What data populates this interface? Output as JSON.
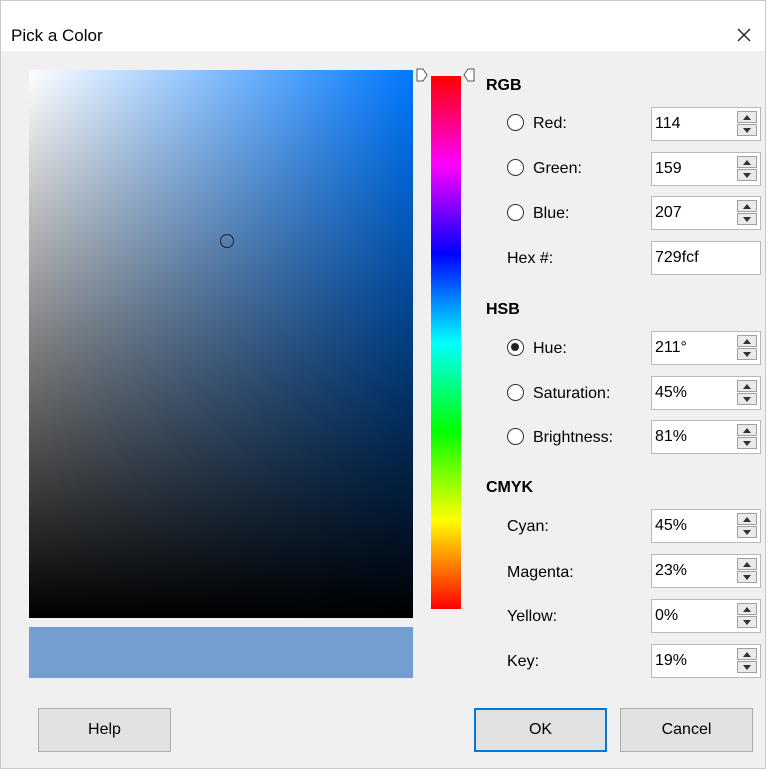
{
  "window": {
    "title": "Pick a Color",
    "close_label": "✕"
  },
  "colors": {
    "field_hue": "#0078ff",
    "preview": "#729fcf"
  },
  "rgb": {
    "heading": "RGB",
    "red": {
      "label": "Red:",
      "value": "114"
    },
    "green": {
      "label": "Green:",
      "value": "159"
    },
    "blue": {
      "label": "Blue:",
      "value": "207"
    },
    "hex": {
      "label": "Hex #:",
      "value": "729fcf"
    }
  },
  "hsb": {
    "heading": "HSB",
    "hue": {
      "label": "Hue:",
      "value": "211°",
      "selected": true
    },
    "saturation": {
      "label": "Saturation:",
      "value": "45%"
    },
    "brightness": {
      "label": "Brightness:",
      "value": "81%"
    }
  },
  "cmyk": {
    "heading": "CMYK",
    "cyan": {
      "label": "Cyan:",
      "value": "45%"
    },
    "magenta": {
      "label": "Magenta:",
      "value": "23%"
    },
    "yellow": {
      "label": "Yellow:",
      "value": "0%"
    },
    "key": {
      "label": "Key:",
      "value": "19%"
    }
  },
  "buttons": {
    "help": "Help",
    "ok": "OK",
    "cancel": "Cancel"
  }
}
